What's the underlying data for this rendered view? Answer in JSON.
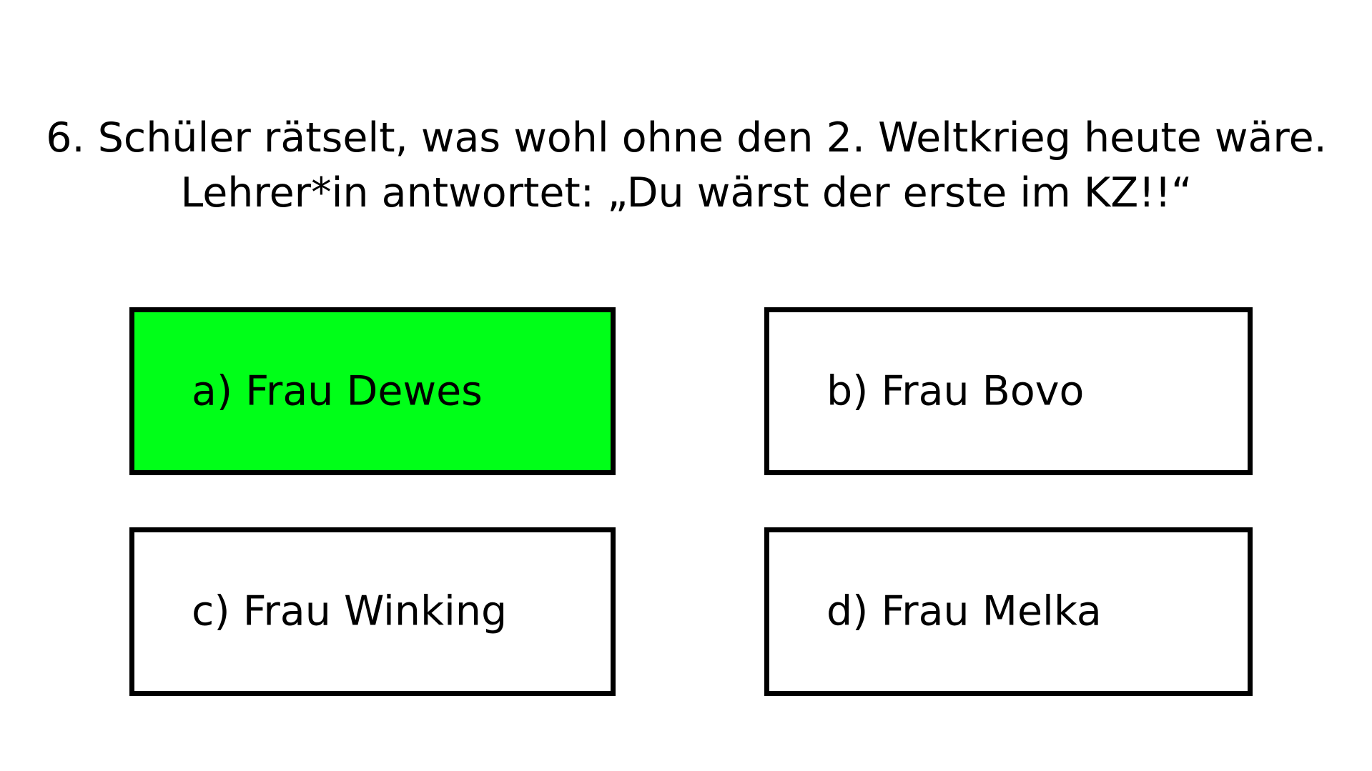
{
  "question": {
    "line1": "6. Schüler rätselt, was wohl ohne den 2. Weltkrieg heute wäre.",
    "line2": "Lehrer*in antwortet: „Du wärst der erste im KZ!!“"
  },
  "answers": [
    {
      "label": "a) Frau Dewes",
      "selected": true
    },
    {
      "label": "b) Frau Bovo",
      "selected": false
    },
    {
      "label": "c) Frau Winking",
      "selected": false
    },
    {
      "label": "d) Frau Melka",
      "selected": false
    }
  ],
  "colors": {
    "background": "#ffffff",
    "selected_fill": "#00ff18",
    "border": "#000000",
    "text": "#000000"
  }
}
